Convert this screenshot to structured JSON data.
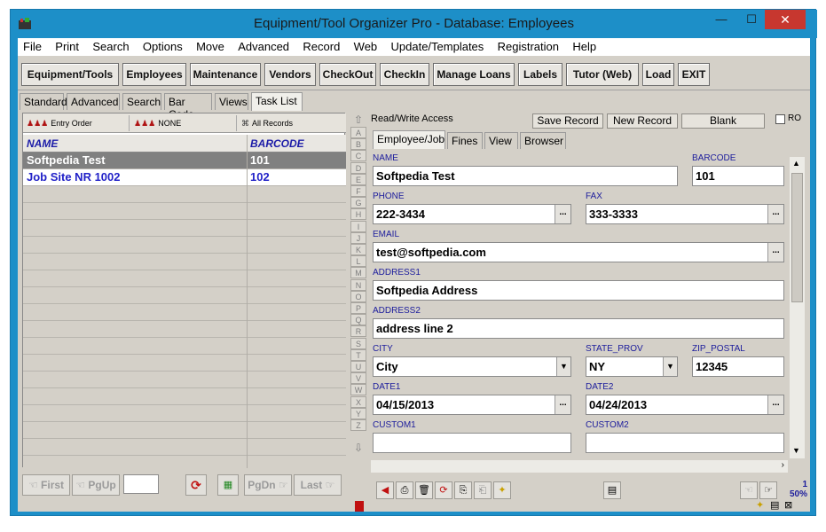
{
  "window": {
    "title": "Equipment/Tool Organizer Pro - Database: Employees"
  },
  "menu": [
    "File",
    "Print",
    "Search",
    "Options",
    "Move",
    "Advanced",
    "Record",
    "Web",
    "Update/Templates",
    "Registration",
    "Help"
  ],
  "toolbar": [
    "Equipment/Tools",
    "Employees",
    "Maintenance",
    "Vendors",
    "CheckOut",
    "CheckIn",
    "Manage Loans",
    "Labels",
    "Tutor (Web)",
    "Load",
    "EXIT"
  ],
  "left_tabs": [
    "Standard",
    "Advanced",
    "Search",
    "Bar Code",
    "Views",
    "Task List"
  ],
  "sort_bar": {
    "order": "Entry Order",
    "filter": "NONE",
    "records": "All Records"
  },
  "grid": {
    "columns": [
      "NAME",
      "BARCODE"
    ],
    "rows": [
      {
        "name": "Softpedia Test",
        "barcode": "101"
      },
      {
        "name": "Job Site NR 1002",
        "barcode": "102"
      }
    ]
  },
  "alphabet": [
    "A",
    "B",
    "C",
    "D",
    "E",
    "F",
    "G",
    "H",
    "I",
    "J",
    "K",
    "L",
    "M",
    "N",
    "O",
    "P",
    "Q",
    "R",
    "S",
    "T",
    "U",
    "V",
    "W",
    "X",
    "Y",
    "Z"
  ],
  "nav_left": [
    "First",
    "PgUp",
    "PgDn",
    "Last"
  ],
  "record_controls": {
    "access": "Read/Write Access",
    "save": "Save Record",
    "new": "New Record",
    "blank": "Blank",
    "ro": "RO"
  },
  "right_tabs": [
    "Employee/Job",
    "Fines",
    "View",
    "Browser"
  ],
  "form": {
    "name_label": "NAME",
    "name": "Softpedia Test",
    "barcode_label": "BARCODE",
    "barcode": "101",
    "phone_label": "PHONE",
    "phone": "222-3434",
    "fax_label": "FAX",
    "fax": "333-3333",
    "email_label": "EMAIL",
    "email": "test@softpedia.com",
    "address1_label": "ADDRESS1",
    "address1": "Softpedia Address",
    "address2_label": "ADDRESS2",
    "address2": "address line 2",
    "city_label": "CITY",
    "city": "City",
    "state_label": "STATE_PROV",
    "state": "NY",
    "zip_label": "ZIP_POSTAL",
    "zip": "12345",
    "date1_label": "DATE1",
    "date1": "04/15/2013",
    "date2_label": "DATE2",
    "date2": "04/24/2013",
    "custom1_label": "CUSTOM1",
    "custom2_label": "CUSTOM2",
    "dots": "..."
  },
  "record_status": {
    "position": "1",
    "zoom": "50%"
  },
  "colors": {
    "accent": "#1d8fc8",
    "selected_row": "#808080",
    "link": "#2222c8",
    "label": "#1c1c9c"
  }
}
